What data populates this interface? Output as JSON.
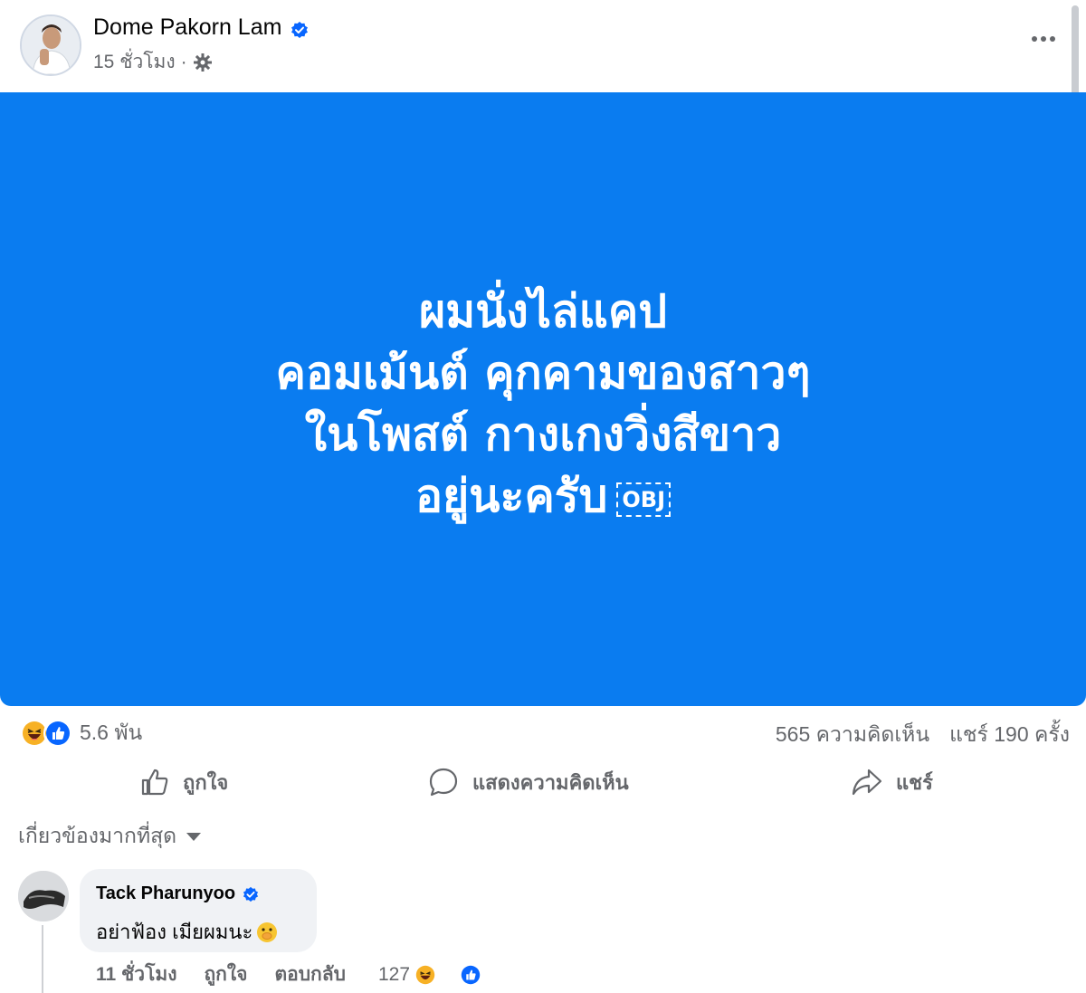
{
  "post": {
    "author": "Dome Pakorn Lam",
    "time": "15 ชั่วโมง",
    "separator": "·",
    "privacy_icon": "settings-gear-icon",
    "more_icon": "more-horizontal-icon",
    "text_lines": [
      "ผมนั่งไล่แคป",
      "คอมเม้นต์ คุกคามของสาวๆ",
      "ในโพสต์ กางเกงวิ่งสีขาว",
      "อยู่นะครับ"
    ],
    "text_symbol": "OBJ",
    "background_color": "#0a7cf0"
  },
  "stats": {
    "reaction_icons": [
      "haha-icon",
      "like-icon"
    ],
    "reactions_count": "5.6 พัน",
    "comments_count": "565 ความคิดเห็น",
    "shares_count": "แชร์ 190 ครั้ง"
  },
  "actions": {
    "like_label": "ถูกใจ",
    "comment_label": "แสดงความคิดเห็น",
    "share_label": "แชร์"
  },
  "comments": {
    "sort_label": "เกี่ยวข้องมากที่สุด",
    "items": [
      {
        "name": "Tack Pharunyoo",
        "text": "อย่าฟ้อง เมียผมนะ",
        "emoji": "face-with-hand-over-mouth",
        "time": "11 ชั่วโมง",
        "like_label": "ถูกใจ",
        "reply_label": "ตอบกลับ",
        "reactions_count": "127"
      }
    ]
  },
  "colors": {
    "facebook_blue": "#0866ff",
    "text_secondary": "#65676b",
    "bubble_bg": "#f0f2f5"
  }
}
